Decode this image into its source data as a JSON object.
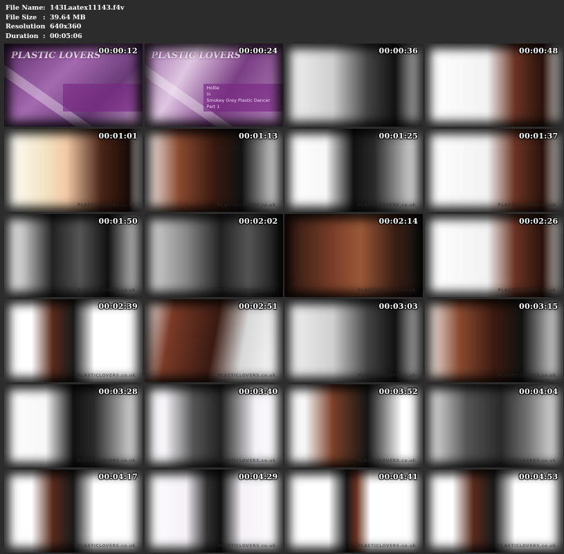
{
  "info": {
    "file_name_label": "File Name",
    "file_name": "143Laatex11143.f4v",
    "file_size_label": "File Size",
    "file_size": "39.64 MB",
    "resolution_label": "Resolution",
    "resolution": "640x360",
    "duration_label": "Duration",
    "duration": "00:05:06",
    "separator": ":"
  },
  "thumbnails": [
    {
      "ts": "00:00:12",
      "logo": "PLASTIC LOVERS",
      "bg": "purple"
    },
    {
      "ts": "00:00:24",
      "logo": "PLASTIC LOVERS",
      "caption_1": "Hollie",
      "caption_2": "in",
      "caption_3": "Smokey Grey Plastic Dancer",
      "caption_4": "Part 1",
      "bg": "purple2"
    },
    {
      "ts": "00:00:36",
      "bg": "mono"
    },
    {
      "ts": "00:00:48",
      "bg": "brown-white"
    },
    {
      "ts": "00:01:01",
      "bg": "face"
    },
    {
      "ts": "00:01:13",
      "bg": "brown-black"
    },
    {
      "ts": "00:01:25",
      "bg": "black-white"
    },
    {
      "ts": "00:01:37",
      "bg": "brown-white"
    },
    {
      "ts": "00:01:50",
      "bg": "mono-dark"
    },
    {
      "ts": "00:02:02",
      "bg": "mono-face"
    },
    {
      "ts": "00:02:14",
      "bg": "brown-dark"
    },
    {
      "ts": "00:02:26",
      "bg": "brown-white"
    },
    {
      "ts": "00:02:39",
      "bg": "figure"
    },
    {
      "ts": "00:02:51",
      "bg": "brown-white2"
    },
    {
      "ts": "00:03:03",
      "bg": "mono"
    },
    {
      "ts": "00:03:15",
      "bg": "brown-black"
    },
    {
      "ts": "00:03:28",
      "bg": "black-white"
    },
    {
      "ts": "00:03:40",
      "bg": "grey-white"
    },
    {
      "ts": "00:03:52",
      "bg": "brown-black2"
    },
    {
      "ts": "00:04:04",
      "bg": "grey-dark"
    },
    {
      "ts": "00:04:17",
      "bg": "figure"
    },
    {
      "ts": "00:04:29",
      "bg": "figure-grey"
    },
    {
      "ts": "00:04:41",
      "bg": "figure-small"
    },
    {
      "ts": "00:04:53",
      "bg": "figure"
    }
  ],
  "watermark": "PLASTICLOVERS.co.uk",
  "colors": {
    "background": "#2c2c2c",
    "text": "#ffffff"
  }
}
